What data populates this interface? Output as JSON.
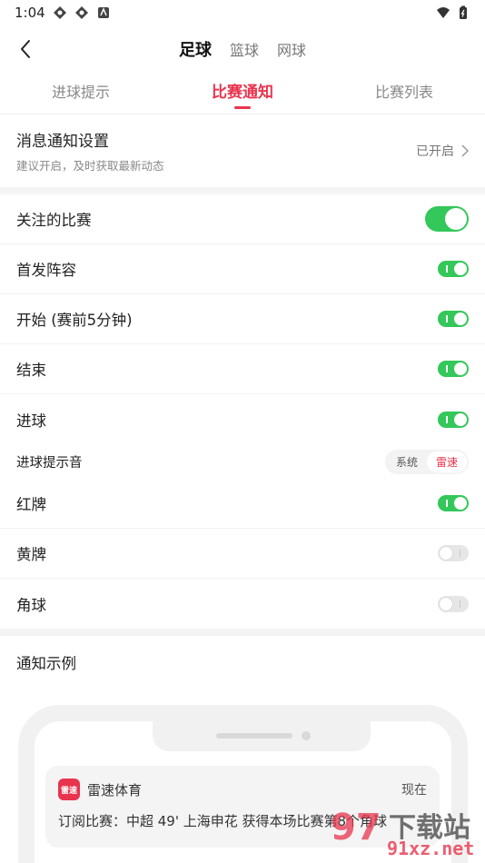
{
  "status": {
    "time": "1:04"
  },
  "nav": {
    "sports": [
      "足球",
      "篮球",
      "网球"
    ]
  },
  "tabs": [
    "进球提示",
    "比赛通知",
    "比赛列表"
  ],
  "notif_setting": {
    "title": "消息通知设置",
    "subtitle": "建议开启，及时获取最新动态",
    "value": "已开启"
  },
  "rows": [
    {
      "label": "关注的比赛",
      "state": "on"
    },
    {
      "label": "首发阵容",
      "state": "on"
    },
    {
      "label": "开始 (赛前5分钟)",
      "state": "on"
    },
    {
      "label": "结束",
      "state": "on"
    },
    {
      "label": "进球",
      "state": "on"
    }
  ],
  "sound": {
    "label": "进球提示音",
    "options": [
      "系统",
      "雷速"
    ],
    "selected": "雷速"
  },
  "rows2": [
    {
      "label": "红牌",
      "state": "on"
    },
    {
      "label": "黄牌",
      "state": "off"
    },
    {
      "label": "角球",
      "state": "off"
    }
  ],
  "example": {
    "title": "通知示例",
    "app_icon_text": "雷速",
    "app_name": "雷速体育",
    "time": "现在",
    "body": "订阅比赛：中超 49' 上海申花 获得本场比赛第8个角球"
  },
  "watermark": {
    "num": "97",
    "cn": "下载站",
    "url": "91xz.net"
  },
  "colors": {
    "accent": "#e8344e",
    "toggle_on": "#34c759"
  }
}
